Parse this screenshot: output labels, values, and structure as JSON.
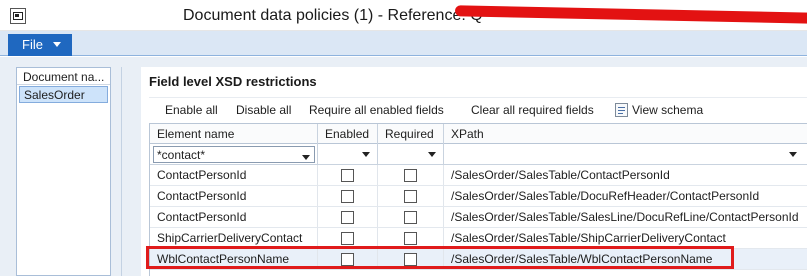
{
  "window": {
    "title": "Document data policies (1) - Reference: Q"
  },
  "menu": {
    "file_label": "File"
  },
  "left_pane": {
    "header": "Document na...",
    "items": [
      "SalesOrder"
    ]
  },
  "section": {
    "title": "Field level XSD restrictions"
  },
  "toolbar": {
    "enable_all": "Enable all",
    "disable_all": "Disable all",
    "require_all_enabled": "Require all enabled fields",
    "clear_all_required": "Clear all required fields",
    "view_schema": "View schema"
  },
  "grid": {
    "columns": [
      "Element name",
      "Enabled",
      "Required",
      "XPath"
    ],
    "filter": {
      "element_name": "*contact*"
    },
    "rows": [
      {
        "element_name": "ContactPersonId",
        "enabled": false,
        "required": false,
        "xpath": "/SalesOrder/SalesTable/ContactPersonId"
      },
      {
        "element_name": "ContactPersonId",
        "enabled": false,
        "required": false,
        "xpath": "/SalesOrder/SalesTable/DocuRefHeader/ContactPersonId"
      },
      {
        "element_name": "ContactPersonId",
        "enabled": false,
        "required": false,
        "xpath": "/SalesOrder/SalesTable/SalesLine/DocuRefLine/ContactPersonId"
      },
      {
        "element_name": "ShipCarrierDeliveryContact",
        "enabled": false,
        "required": false,
        "xpath": "/SalesOrder/SalesTable/ShipCarrierDeliveryContact"
      },
      {
        "element_name": "WblContactPersonName",
        "enabled": false,
        "required": false,
        "xpath": "/SalesOrder/SalesTable/WblContactPersonName"
      }
    ]
  },
  "colors": {
    "highlight": "#e01b1b",
    "file_button": "#1f68c0",
    "ribbon": "#dbe7f5"
  }
}
